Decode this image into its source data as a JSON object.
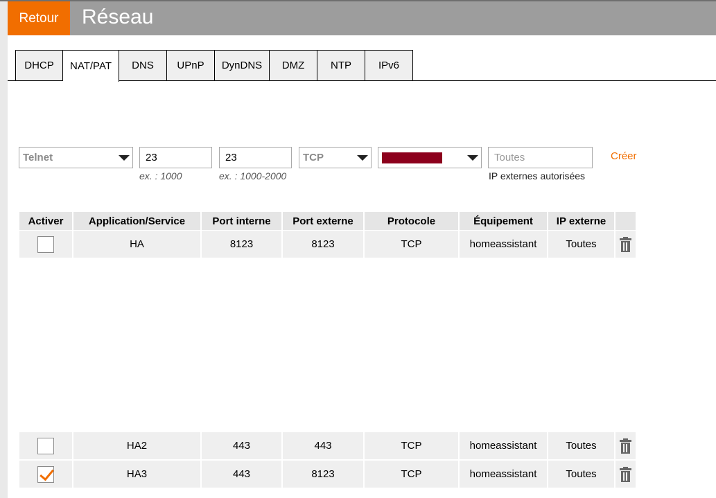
{
  "header": {
    "back_label": "Retour",
    "title": "Réseau"
  },
  "tabs": [
    {
      "label": "DHCP"
    },
    {
      "label": "NAT/PAT"
    },
    {
      "label": "DNS"
    },
    {
      "label": "UPnP"
    },
    {
      "label": "DynDNS"
    },
    {
      "label": "DMZ"
    },
    {
      "label": "NTP"
    },
    {
      "label": "IPv6"
    }
  ],
  "active_tab": "NAT/PAT",
  "form": {
    "service_value": "Telnet",
    "internal_port_value": "23",
    "internal_port_hint": "ex. : 1000",
    "external_port_value": "23",
    "external_port_hint": "ex. : 1000-2000",
    "protocol_value": "TCP",
    "ip_placeholder": "Toutes",
    "ip_hint": "IP externes autorisées",
    "create_label": "Créer"
  },
  "table": {
    "headers": [
      "Activer",
      "Application/Service",
      "Port interne",
      "Port externe",
      "Protocole",
      "Équipement",
      "IP externe"
    ],
    "rows": [
      {
        "enabled": false,
        "service": "HA",
        "internal_port": "8123",
        "external_port": "8123",
        "protocol": "TCP",
        "device": "homeassistant",
        "external_ip": "Toutes"
      },
      {
        "enabled": false,
        "service": "HA2",
        "internal_port": "443",
        "external_port": "443",
        "protocol": "TCP",
        "device": "homeassistant",
        "external_ip": "Toutes"
      },
      {
        "enabled": true,
        "service": "HA3",
        "internal_port": "443",
        "external_port": "8123",
        "protocol": "TCP",
        "device": "homeassistant",
        "external_ip": "Toutes"
      }
    ]
  },
  "colors": {
    "accent": "#f16e00",
    "header_bg": "#9d9d9d",
    "redaction": "#8c001c"
  }
}
